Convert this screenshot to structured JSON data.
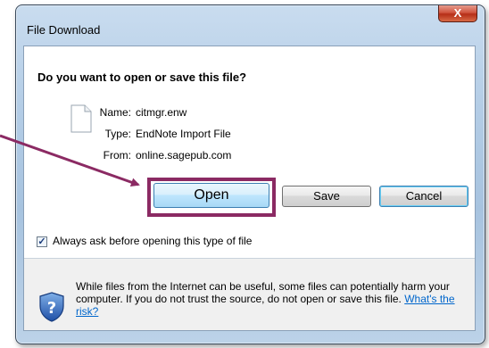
{
  "window": {
    "title": "File Download",
    "close_glyph": "X"
  },
  "dialog": {
    "question": "Do you want to open or save this file?",
    "file": {
      "name_label": "Name:",
      "name_value": "citmgr.enw",
      "type_label": "Type:",
      "type_value": "EndNote Import File",
      "from_label": "From:",
      "from_value": "online.sagepub.com"
    },
    "buttons": {
      "open": "Open",
      "save": "Save",
      "cancel": "Cancel"
    },
    "checkbox": {
      "checked": true,
      "label": "Always ask before opening this type of file"
    },
    "warning": {
      "text": "While files from the Internet can be useful, some files can potentially harm your computer. If you do not trust the source, do not open or save this file.",
      "link": "What's the risk?"
    }
  },
  "colors": {
    "annotation": "#8b2a63",
    "accent": "#3c7fb1"
  }
}
